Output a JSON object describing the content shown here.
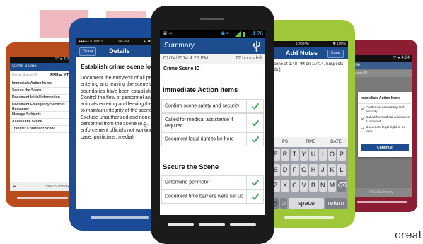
{
  "brand_colors": {
    "navy": "#1d4c8f",
    "orange": "#b94d1d",
    "blue": "#1c4c98",
    "black": "#1b1b1b",
    "green": "#9fc73a",
    "red": "#8c1d33",
    "check": "#36a14a"
  },
  "phone_orange": {
    "status": "▽ ● 4 4:2",
    "title": "Crime Scene",
    "id_label": "Crime Scene ID",
    "id_value": "FIRE at MTSU",
    "items": [
      "Immediate Action Items",
      "Secure the Scene",
      "Document Initial Information",
      "Document Emergency Services Response",
      "Manage Subjects",
      "Assess the Scene",
      "Transfer Control of Scene"
    ],
    "footer_left": "≡",
    "footer_right": "View Summary"
  },
  "phone_blue": {
    "status_left": "●●●●○ eTelco ≈",
    "status_time": "1:45 PM",
    "status_right": "▲ ✱ 100%",
    "done": "Done",
    "title": "Details",
    "heading": "Establish crime scene log",
    "body_lines": [
      "Document the entry/exit of all peo",
      "entering and leaving the scene on",
      "boundaries have been established",
      "Control the flow of personnel and",
      "animals entering and leaving the s",
      "to maintain integrity of the scene,",
      "Exclude unauthorized and noness",
      "personnel from the scene (e.g., la",
      "enforcement officials not working",
      "case, politicians, media)."
    ]
  },
  "phone_black": {
    "status_left": "▣ ∞",
    "status_icons": "◉ ≈",
    "status_time": "4:26",
    "title": "Summary",
    "date": "01/14/2014 4:25 PM",
    "time_left": "72 hours left",
    "id_label": "Crime Scene ID",
    "section1": "Immediate Action Items",
    "items1": [
      "Confirm scene safety and security",
      "Called for medical assistance if required",
      "Document legal right to be here"
    ],
    "section2": "Secure the Scene",
    "items2": [
      "Determine perimeter",
      "Document time barriers were set up"
    ]
  },
  "phone_green": {
    "status_left": "≈",
    "status_time": "1:48 PM",
    "status_right": "✱ 100%",
    "title": "Add Notes",
    "save": "Save",
    "note_line1": "scene at 1:48 PM on 1/7/14. Suspects",
    "note_line2": "ody.]",
    "quick_keys": [
      "PS",
      "TIME",
      "DATE"
    ],
    "key_rows": [
      [
        "E",
        "R",
        "T",
        "Y",
        "U",
        "I",
        "O",
        "P"
      ],
      [
        "S",
        "D",
        "F",
        "G",
        "H",
        "J",
        "K",
        "L"
      ],
      [
        "Z",
        "X",
        "C",
        "V",
        "B",
        "N",
        "M",
        "⌫"
      ]
    ],
    "space": "space",
    "return": "return"
  },
  "phone_red": {
    "status": "▽ ● 4:24",
    "title": "ene",
    "id_value": "Scene ID",
    "dialog_title": "Immediate Action Items",
    "dialog_items": [
      "Confirm scene safety and security.",
      "Called for medical assistance if required.",
      "Document legal right to be here."
    ],
    "continue": "Continue",
    "footer": "View Summary"
  },
  "caption": "create"
}
